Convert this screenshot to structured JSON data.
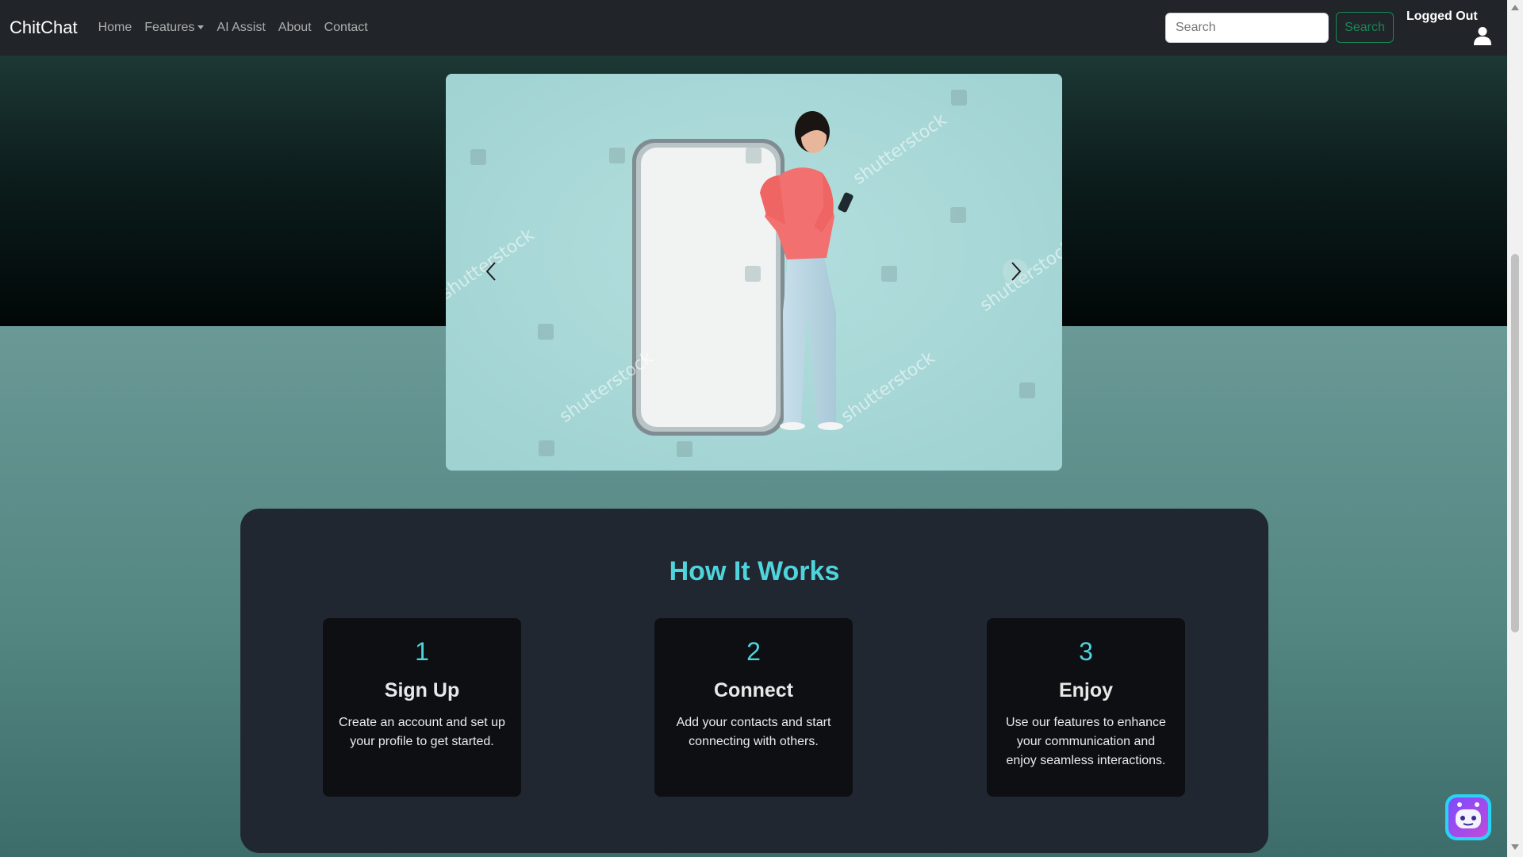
{
  "navbar": {
    "brand": "ChitChat",
    "links": [
      "Home",
      "Features",
      "AI Assist",
      "About",
      "Contact"
    ],
    "search_placeholder": "Search",
    "search_button": "Search",
    "login_status": "Logged Out"
  },
  "carousel": {
    "prev_icon": "chevron-left-icon",
    "next_icon": "chevron-right-icon",
    "slide_image": "woman-with-smartphone-mockup"
  },
  "how_it_works": {
    "title": "How It Works",
    "steps": [
      {
        "number": "1",
        "title": "Sign Up",
        "description": "Create an account and set up your profile to get started."
      },
      {
        "number": "2",
        "title": "Connect",
        "description": "Add your contacts and start connecting with others."
      },
      {
        "number": "3",
        "title": "Enjoy",
        "description": "Use our features to enhance your communication and enjoy seamless interactions."
      }
    ]
  },
  "chatbot": {
    "icon": "robot-chat-icon"
  },
  "colors": {
    "navbar": "#212529",
    "accent": "#4fd4dc",
    "search_button": "#198754",
    "panel": "#212731",
    "card": "#0d0f12"
  }
}
